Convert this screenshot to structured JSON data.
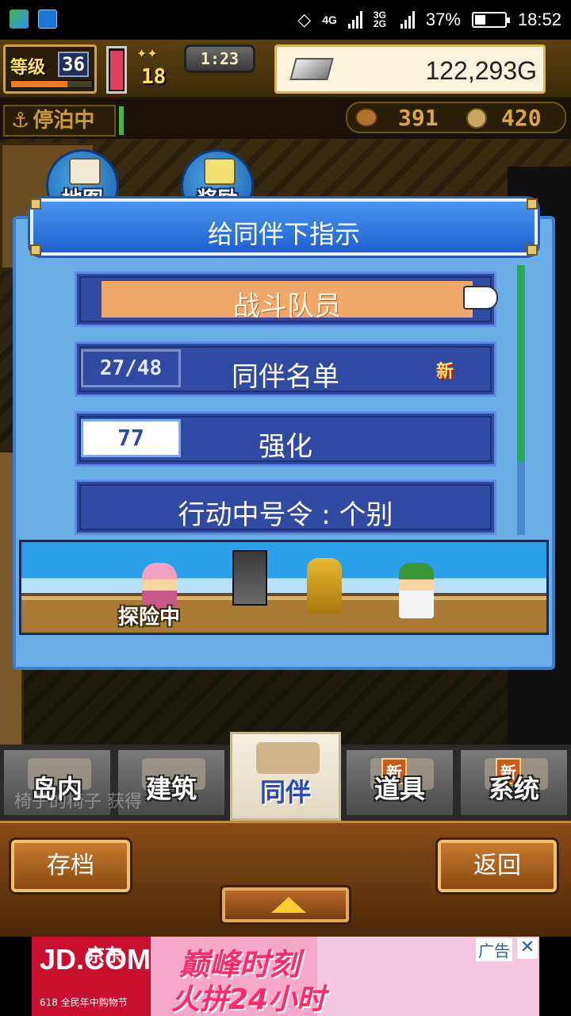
{
  "status_bar": {
    "network": "4G",
    "network2": "3G 2G",
    "battery": "37%",
    "battery_level": 0.37,
    "time": "18:52"
  },
  "hud": {
    "level_label": "等级",
    "level": "36",
    "level_progress": 0.7,
    "hp_fraction": 0.9,
    "stamina": "18",
    "clock": "1:23",
    "gold": "122,293G",
    "dock_status": "停泊中",
    "resource1": "391",
    "resource2": "420"
  },
  "shortcuts": {
    "map": "地图",
    "reward": "奖励"
  },
  "dialog": {
    "title": "给同伴下指示",
    "items": [
      {
        "label": "战斗队员"
      },
      {
        "label": "同伴名单",
        "count": "27/48",
        "badge": "新"
      },
      {
        "label": "强化",
        "value": "77"
      },
      {
        "label": "行动中号令 : 个别"
      }
    ],
    "scroll_fraction": 0.73
  },
  "expedition": {
    "status": "探险中"
  },
  "tabs": [
    {
      "label": "岛内"
    },
    {
      "label": "建筑"
    },
    {
      "label": "同伴",
      "active": true
    },
    {
      "label": "道具",
      "badge": "新"
    },
    {
      "label": "系统",
      "badge": "新"
    }
  ],
  "ticker_text": "椅子的椅子 获得",
  "buttons": {
    "save": "存档",
    "back": "返回"
  },
  "ad": {
    "brand": "JD.COM",
    "brand_cn": "京东",
    "sub": "618 全民年中购物节",
    "line1": "巅峰时刻",
    "line2": "火拼24小时",
    "label": "广告",
    "close": "✕"
  },
  "icons": {
    "hand": "pointing-hand-icon",
    "arrow_up": "arrow-up-icon",
    "anchor": "anchor-icon",
    "silver": "silver-ingot-icon"
  }
}
